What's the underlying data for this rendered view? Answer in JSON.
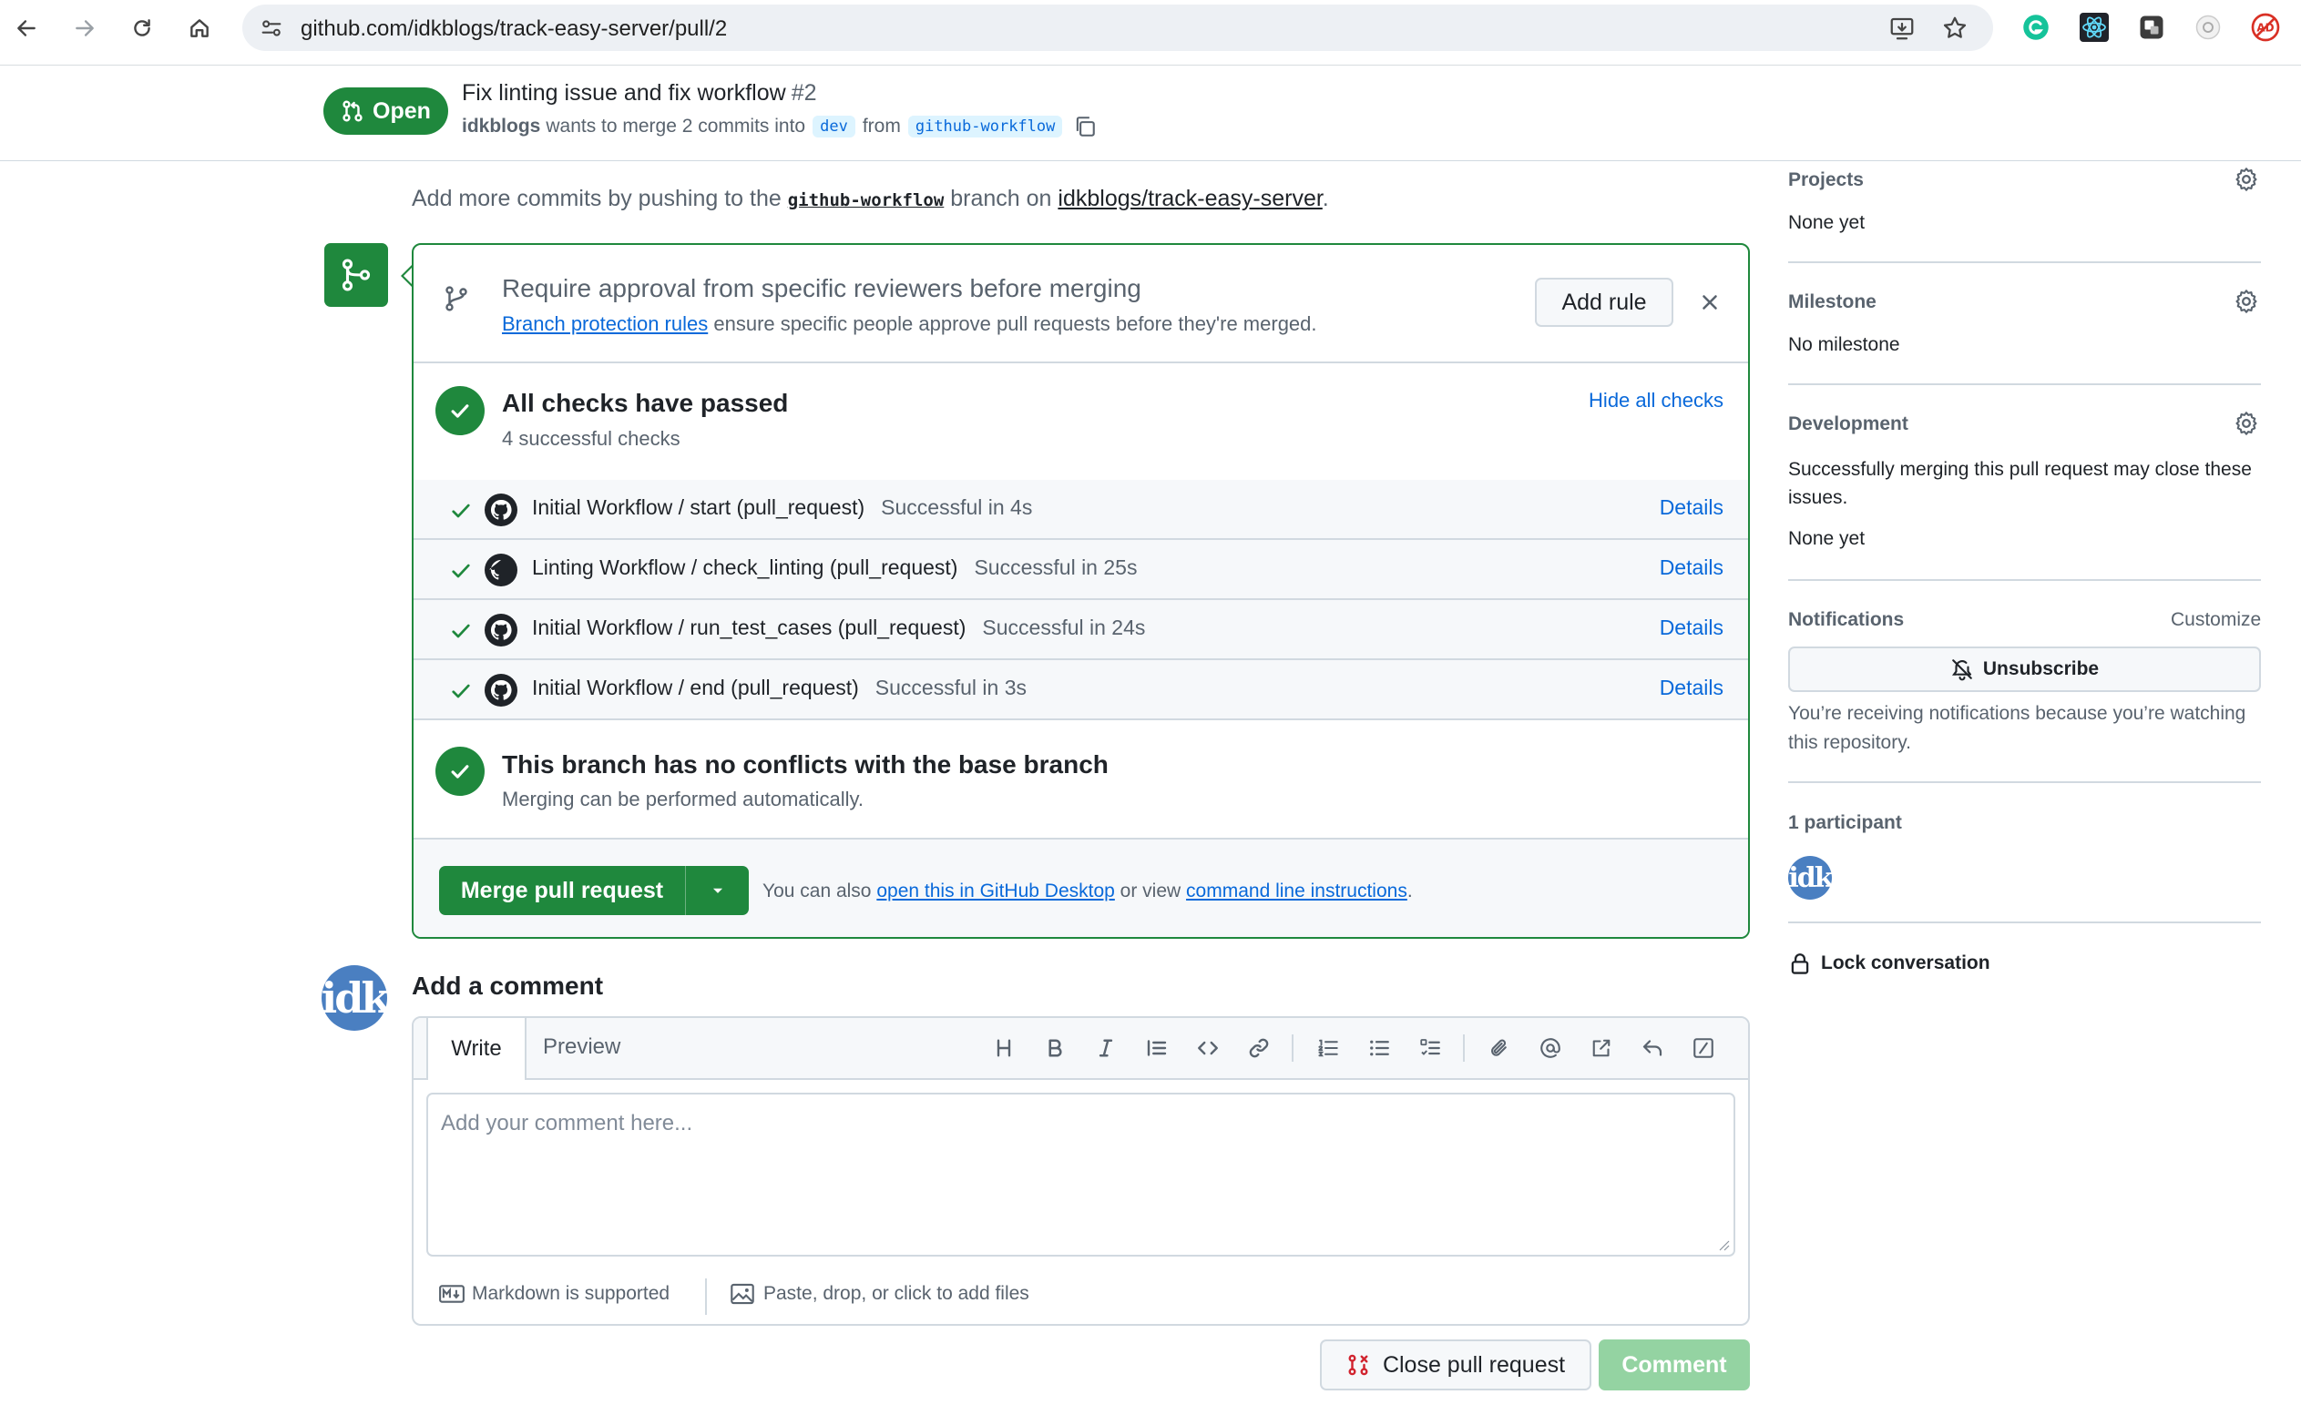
{
  "browser": {
    "url": "github.com/idkblogs/track-easy-server/pull/2",
    "extension_icons": [
      "grammarly-icon",
      "react-devtools-icon",
      "extension-icon",
      "extension-icon",
      "adblock-icon"
    ]
  },
  "pr": {
    "state": "Open",
    "title": "Fix linting issue and fix workflow",
    "number": "#2",
    "author": "idkblogs",
    "merge_text": "wants to merge 2 commits into",
    "base_branch": "dev",
    "from_text": "from",
    "head_branch": "github-workflow"
  },
  "main": {
    "add_commits": {
      "prefix": "Add more commits by pushing to the",
      "branch": "github-workflow",
      "middle": "branch on",
      "repo": "idkblogs/track-easy-server",
      "suffix": "."
    },
    "rule_prompt": {
      "title": "Require approval from specific reviewers before merging",
      "link": "Branch protection rules",
      "text": "ensure specific people approve pull requests before they're merged.",
      "button": "Add rule"
    },
    "checks": {
      "title": "All checks have passed",
      "subtitle": "4 successful checks",
      "toggle": "Hide all checks",
      "items": [
        {
          "name": "Initial Workflow / start (pull_request)",
          "status": "Successful in 4s",
          "link": "Details"
        },
        {
          "name": "Linting Workflow / check_linting (pull_request)",
          "status": "Successful in 25s",
          "link": "Details"
        },
        {
          "name": "Initial Workflow / run_test_cases (pull_request)",
          "status": "Successful in 24s",
          "link": "Details"
        },
        {
          "name": "Initial Workflow / end (pull_request)",
          "status": "Successful in 3s",
          "link": "Details"
        }
      ]
    },
    "conflicts": {
      "title": "This branch has no conflicts with the base branch",
      "subtitle": "Merging can be performed automatically."
    },
    "merge": {
      "button": "Merge pull request",
      "also_text": "You can also",
      "desktop_link": "open this in GitHub Desktop",
      "or_text": "or view",
      "cli_link": "command line instructions",
      "period": "."
    },
    "comment": {
      "heading": "Add a comment",
      "tab_write": "Write",
      "tab_preview": "Preview",
      "placeholder": "Add your comment here...",
      "markdown_note": "Markdown is supported",
      "attach_note": "Paste, drop, or click to add files",
      "avatar_text": "idk",
      "close_button": "Close pull request",
      "comment_button": "Comment"
    }
  },
  "sidebar": {
    "projects": {
      "label": "Projects",
      "value": "None yet"
    },
    "milestone": {
      "label": "Milestone",
      "value": "No milestone"
    },
    "development": {
      "label": "Development",
      "text": "Successfully merging this pull request may close these issues.",
      "value": "None yet"
    },
    "notifications": {
      "label": "Notifications",
      "customize": "Customize",
      "button": "Unsubscribe",
      "text": "You’re receiving notifications because you’re watching this repository."
    },
    "participants": {
      "label": "1 participant",
      "avatar_text": "idk"
    },
    "lock": "Lock conversation"
  },
  "colors": {
    "success_green": "#1f883d",
    "link_blue": "#0969da",
    "muted_text": "#59636e",
    "border": "#d1d9e0",
    "comment_disabled": "#94d3a2"
  }
}
